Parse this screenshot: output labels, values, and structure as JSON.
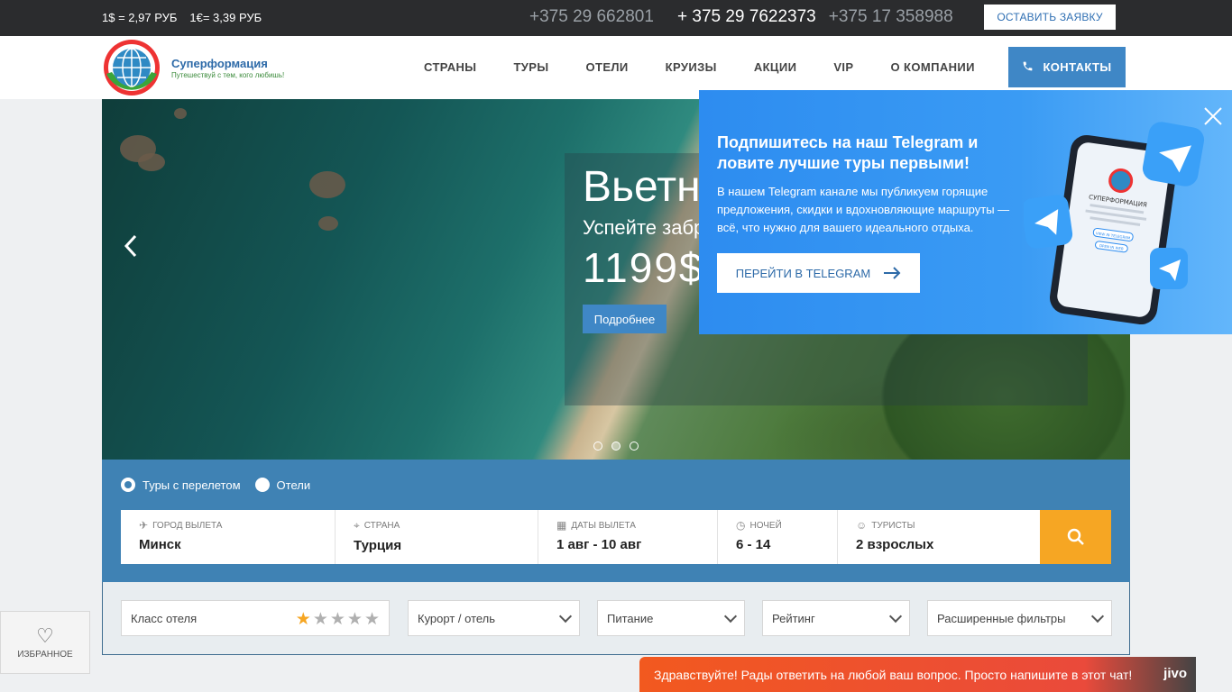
{
  "topbar": {
    "rate_usd": "1$ = 2,97 РУБ",
    "rate_eur": "1€= 3,39 РУБ",
    "phone_1": "+375 29 662801",
    "phone_2": "+ 375 29 7622373",
    "phone_3": "+375 17 358988",
    "request_button": "ОСТАВИТЬ ЗАЯВКУ"
  },
  "header": {
    "logo_name": "Суперформация",
    "logo_tagline": "Путешествуй с тем, кого любишь!",
    "logo_ring": "СУПЕРФОРМАЦИЯ",
    "nav": [
      {
        "label": "СТРАНЫ"
      },
      {
        "label": "ТУРЫ"
      },
      {
        "label": "ОТЕЛИ"
      },
      {
        "label": "КРУИЗЫ"
      },
      {
        "label": "АКЦИИ"
      },
      {
        "label": "VIP"
      },
      {
        "label": "О КОМПАНИИ"
      }
    ],
    "contacts_button": "КОНТАКТЫ"
  },
  "slider": {
    "title": "Вьетнам",
    "subtitle": "Успейте забронировать",
    "price": "1199$",
    "more_button": "Подробнее",
    "slide_count": 3,
    "active_slide": 2
  },
  "search": {
    "radio_tours": "Туры с перелетом",
    "radio_hotels": "Отели",
    "selected_radio": "tours",
    "fields": {
      "departure_label": "ГОРОД ВЫЛЕТА",
      "departure_value": "Минск",
      "country_label": "СТРАНА",
      "country_value": "Турция",
      "dates_label": "ДАТЫ ВЫЛЕТА",
      "dates_value": "1 авг - 10 авг",
      "nights_label": "НОЧЕЙ",
      "nights_value": "6 - 14",
      "tourists_label": "ТУРИСТЫ",
      "tourists_value": "2 взрослых"
    }
  },
  "filters": {
    "hotel_class": "Класс отеля",
    "hotel_class_stars": 1,
    "resort": "Курорт / отель",
    "meals": "Питание",
    "rating": "Рейтинг",
    "advanced": "Расширенные фильтры"
  },
  "favorites": {
    "label": "ИЗБРАННОЕ"
  },
  "telegram_popup": {
    "title": "Подпишитесь на наш Telegram и ловите лучшие туры первыми!",
    "text": "В нашем Telegram канале мы публикуем горящие предложения, скидки и вдохновляющие маршруты — всё, что нужно для вашего идеального отдыха.",
    "button": "ПЕРЕЙТИ В TELEGRAM",
    "mock_brand": "СУПЕРФОРМАЦИЯ",
    "mock_btn_1": "VIEW IN TELEGRAM",
    "mock_btn_2": "OPEN IN WEB"
  },
  "chat": {
    "message": "Здравствуйте! Рады ответить на любой ваш вопрос. Просто напишите в этот чат!",
    "brand": "jivo"
  },
  "colors": {
    "accent_blue": "#3f87c6",
    "search_bg": "#3f82b4",
    "search_button": "#f6a623",
    "telegram_bg": "#2d8cf0",
    "chat_bg": "#f2591f"
  }
}
